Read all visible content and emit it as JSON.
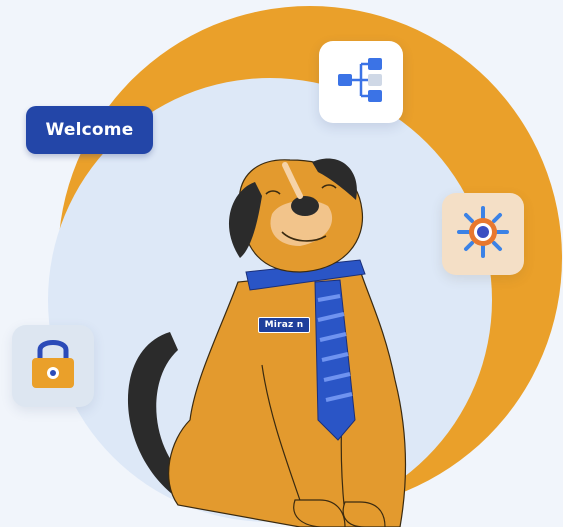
{
  "welcome": {
    "label": "Welcome"
  },
  "mascot": {
    "name_tag": "Miraz n"
  },
  "icons": {
    "flow": "flowchart-icon",
    "target": "target-icon",
    "lock": "padlock-icon"
  },
  "colors": {
    "background": "#f1f5fb",
    "ring": "#eaa02a",
    "inner_circle": "#dde8f7",
    "brand_blue": "#2346a8",
    "dog_fur": "#e39a2e",
    "dog_ear": "#2b2b2b"
  }
}
